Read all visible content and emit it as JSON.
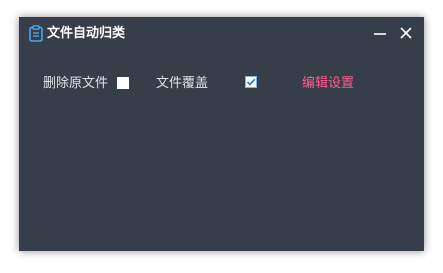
{
  "window": {
    "title": "文件自动归类",
    "icon": "clipboard-icon",
    "controls": {
      "minimize_icon": "minimize-icon",
      "close_icon": "close-icon"
    }
  },
  "options": {
    "delete_original_label": "删除原文件",
    "delete_original_checked": false,
    "overwrite_label": "文件覆盖",
    "overwrite_checked": true,
    "edit_settings_label": "编辑设置"
  },
  "colors": {
    "window_bg": "#363e49",
    "title_text": "#ffffff",
    "label_text": "#dfe3e8",
    "link": "#ff5c92",
    "icon_accent": "#4aa3f0",
    "checkbox_checked": "#2b7fd4"
  }
}
